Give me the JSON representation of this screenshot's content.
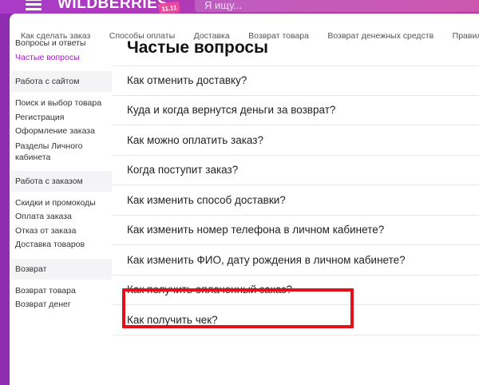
{
  "header": {
    "logo_text": "WILDBERRIES",
    "promo_badge": "11.11",
    "search_placeholder": "Я ищу..."
  },
  "subnav": [
    "Как сделать заказ",
    "Способы оплаты",
    "Доставка",
    "Возврат товара",
    "Возврат денежных средств",
    "Правила про"
  ],
  "sidebar": {
    "top_links": [
      {
        "label": "Вопросы и ответы",
        "active": false
      },
      {
        "label": "Частые вопросы",
        "active": true
      }
    ],
    "sections": [
      {
        "title": "Работа с сайтом",
        "links": [
          "Поиск и выбор товара",
          "Регистрация",
          "Оформление заказа",
          "Разделы Личного кабинета"
        ]
      },
      {
        "title": "Работа с заказом",
        "links": [
          "Скидки и промокоды",
          "Оплата заказа",
          "Отказ от заказа",
          "Доставка товаров"
        ]
      },
      {
        "title": "Возврат",
        "links": [
          "Возврат товара",
          "Возврат денег"
        ]
      }
    ]
  },
  "main": {
    "title": "Частые вопросы",
    "questions": [
      "Как отменить доставку?",
      "Куда и когда вернутся деньги за возврат?",
      "Как можно оплатить заказ?",
      "Когда поступит заказ?",
      "Как изменить способ доставки?",
      "Как изменить номер телефона в личном кабинете?",
      "Как изменить ФИО, дату рождения в личном кабинете?",
      "Как получить оплаченный заказ?",
      "Как получить чек?"
    ],
    "highlighted_question_index": 7
  },
  "colors": {
    "header_purple": "#a93bc8",
    "active_link": "#a21ec3",
    "highlight_border": "#e3101a"
  }
}
